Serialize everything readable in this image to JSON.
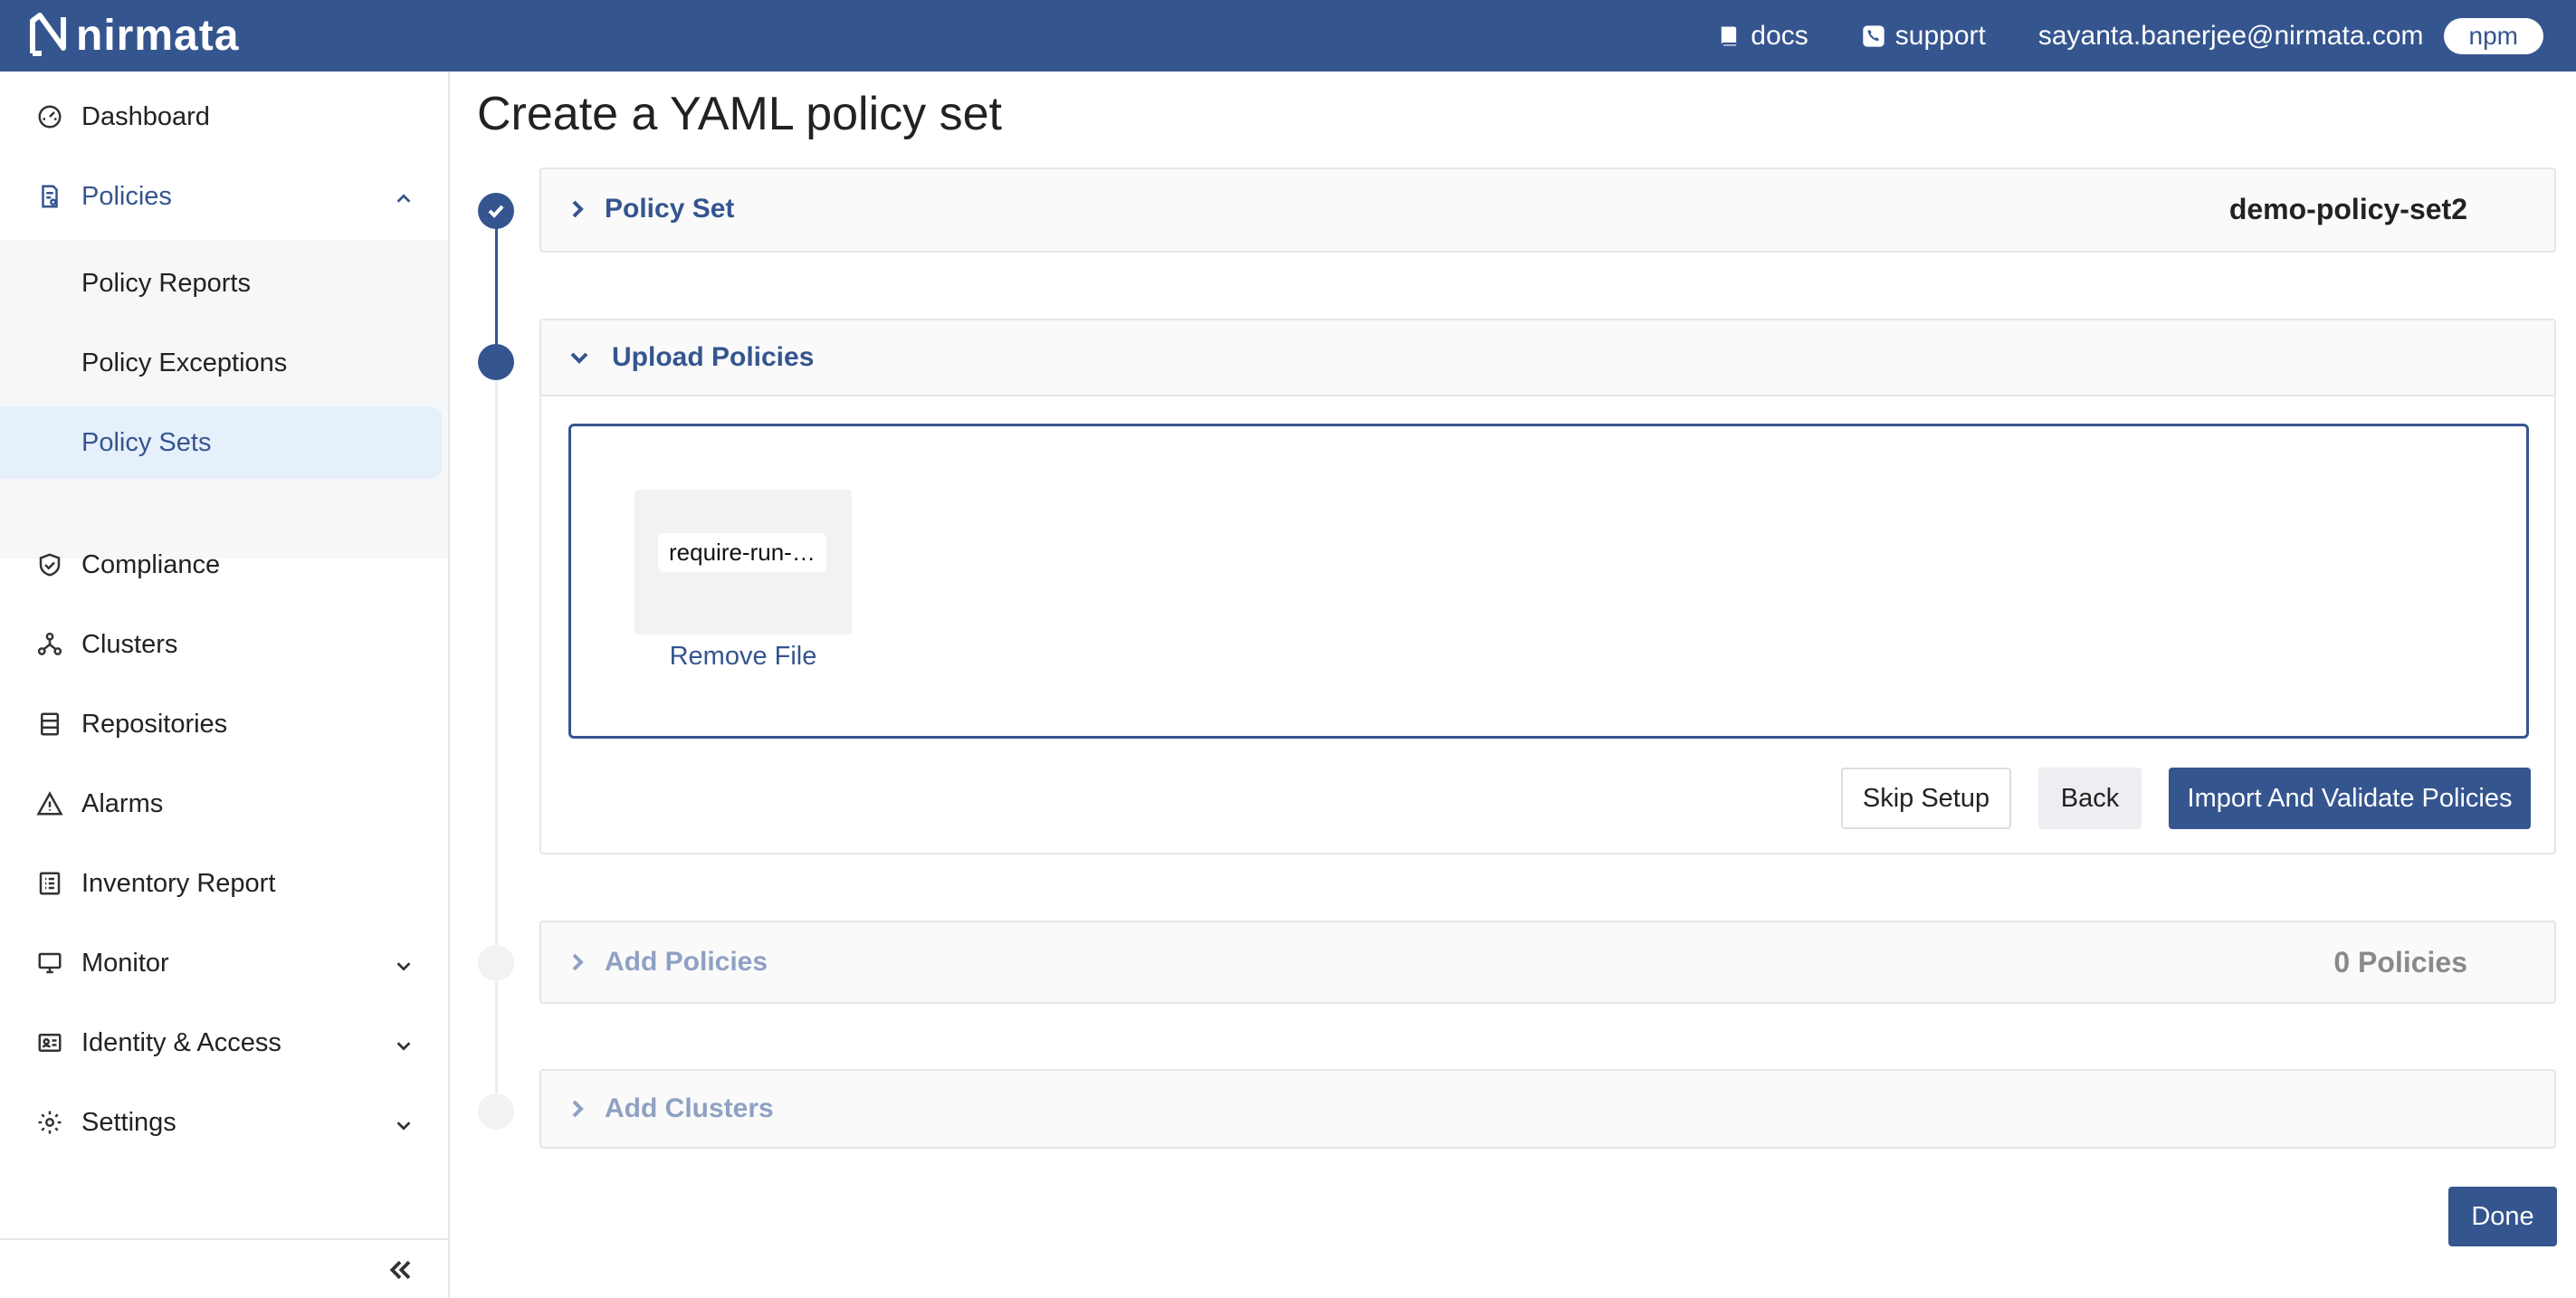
{
  "brand": {
    "name": "nirmata"
  },
  "topbar": {
    "docs_label": "docs",
    "support_label": "support",
    "user_email": "sayanta.banerjee@nirmata.com",
    "tenant": "npm"
  },
  "sidebar": {
    "items": {
      "dashboard": "Dashboard",
      "policies": "Policies",
      "policy_reports": "Policy Reports",
      "policy_exceptions": "Policy Exceptions",
      "policy_sets": "Policy Sets",
      "compliance": "Compliance",
      "clusters": "Clusters",
      "repositories": "Repositories",
      "alarms": "Alarms",
      "inventory_report": "Inventory Report",
      "monitor": "Monitor",
      "identity_access": "Identity & Access",
      "settings": "Settings"
    },
    "active_item": "Policy Sets"
  },
  "main": {
    "title": "Create a YAML policy set",
    "steps": {
      "policy_set": {
        "label": "Policy Set",
        "value": "demo-policy-set2",
        "status": "completed"
      },
      "upload_policies": {
        "label": "Upload Policies",
        "status": "active"
      },
      "add_policies": {
        "label": "Add Policies",
        "value": "0 Policies",
        "status": "pending"
      },
      "add_clusters": {
        "label": "Add Clusters",
        "status": "pending"
      }
    },
    "upload": {
      "file_name": "require-run-…",
      "remove_label": "Remove File"
    },
    "buttons": {
      "skip": "Skip Setup",
      "back": "Back",
      "import": "Import And Validate Policies",
      "done": "Done"
    }
  },
  "colors": {
    "brand": "#35558f",
    "active_bg": "#e6f0fb",
    "pending": "#8fa1c3"
  }
}
